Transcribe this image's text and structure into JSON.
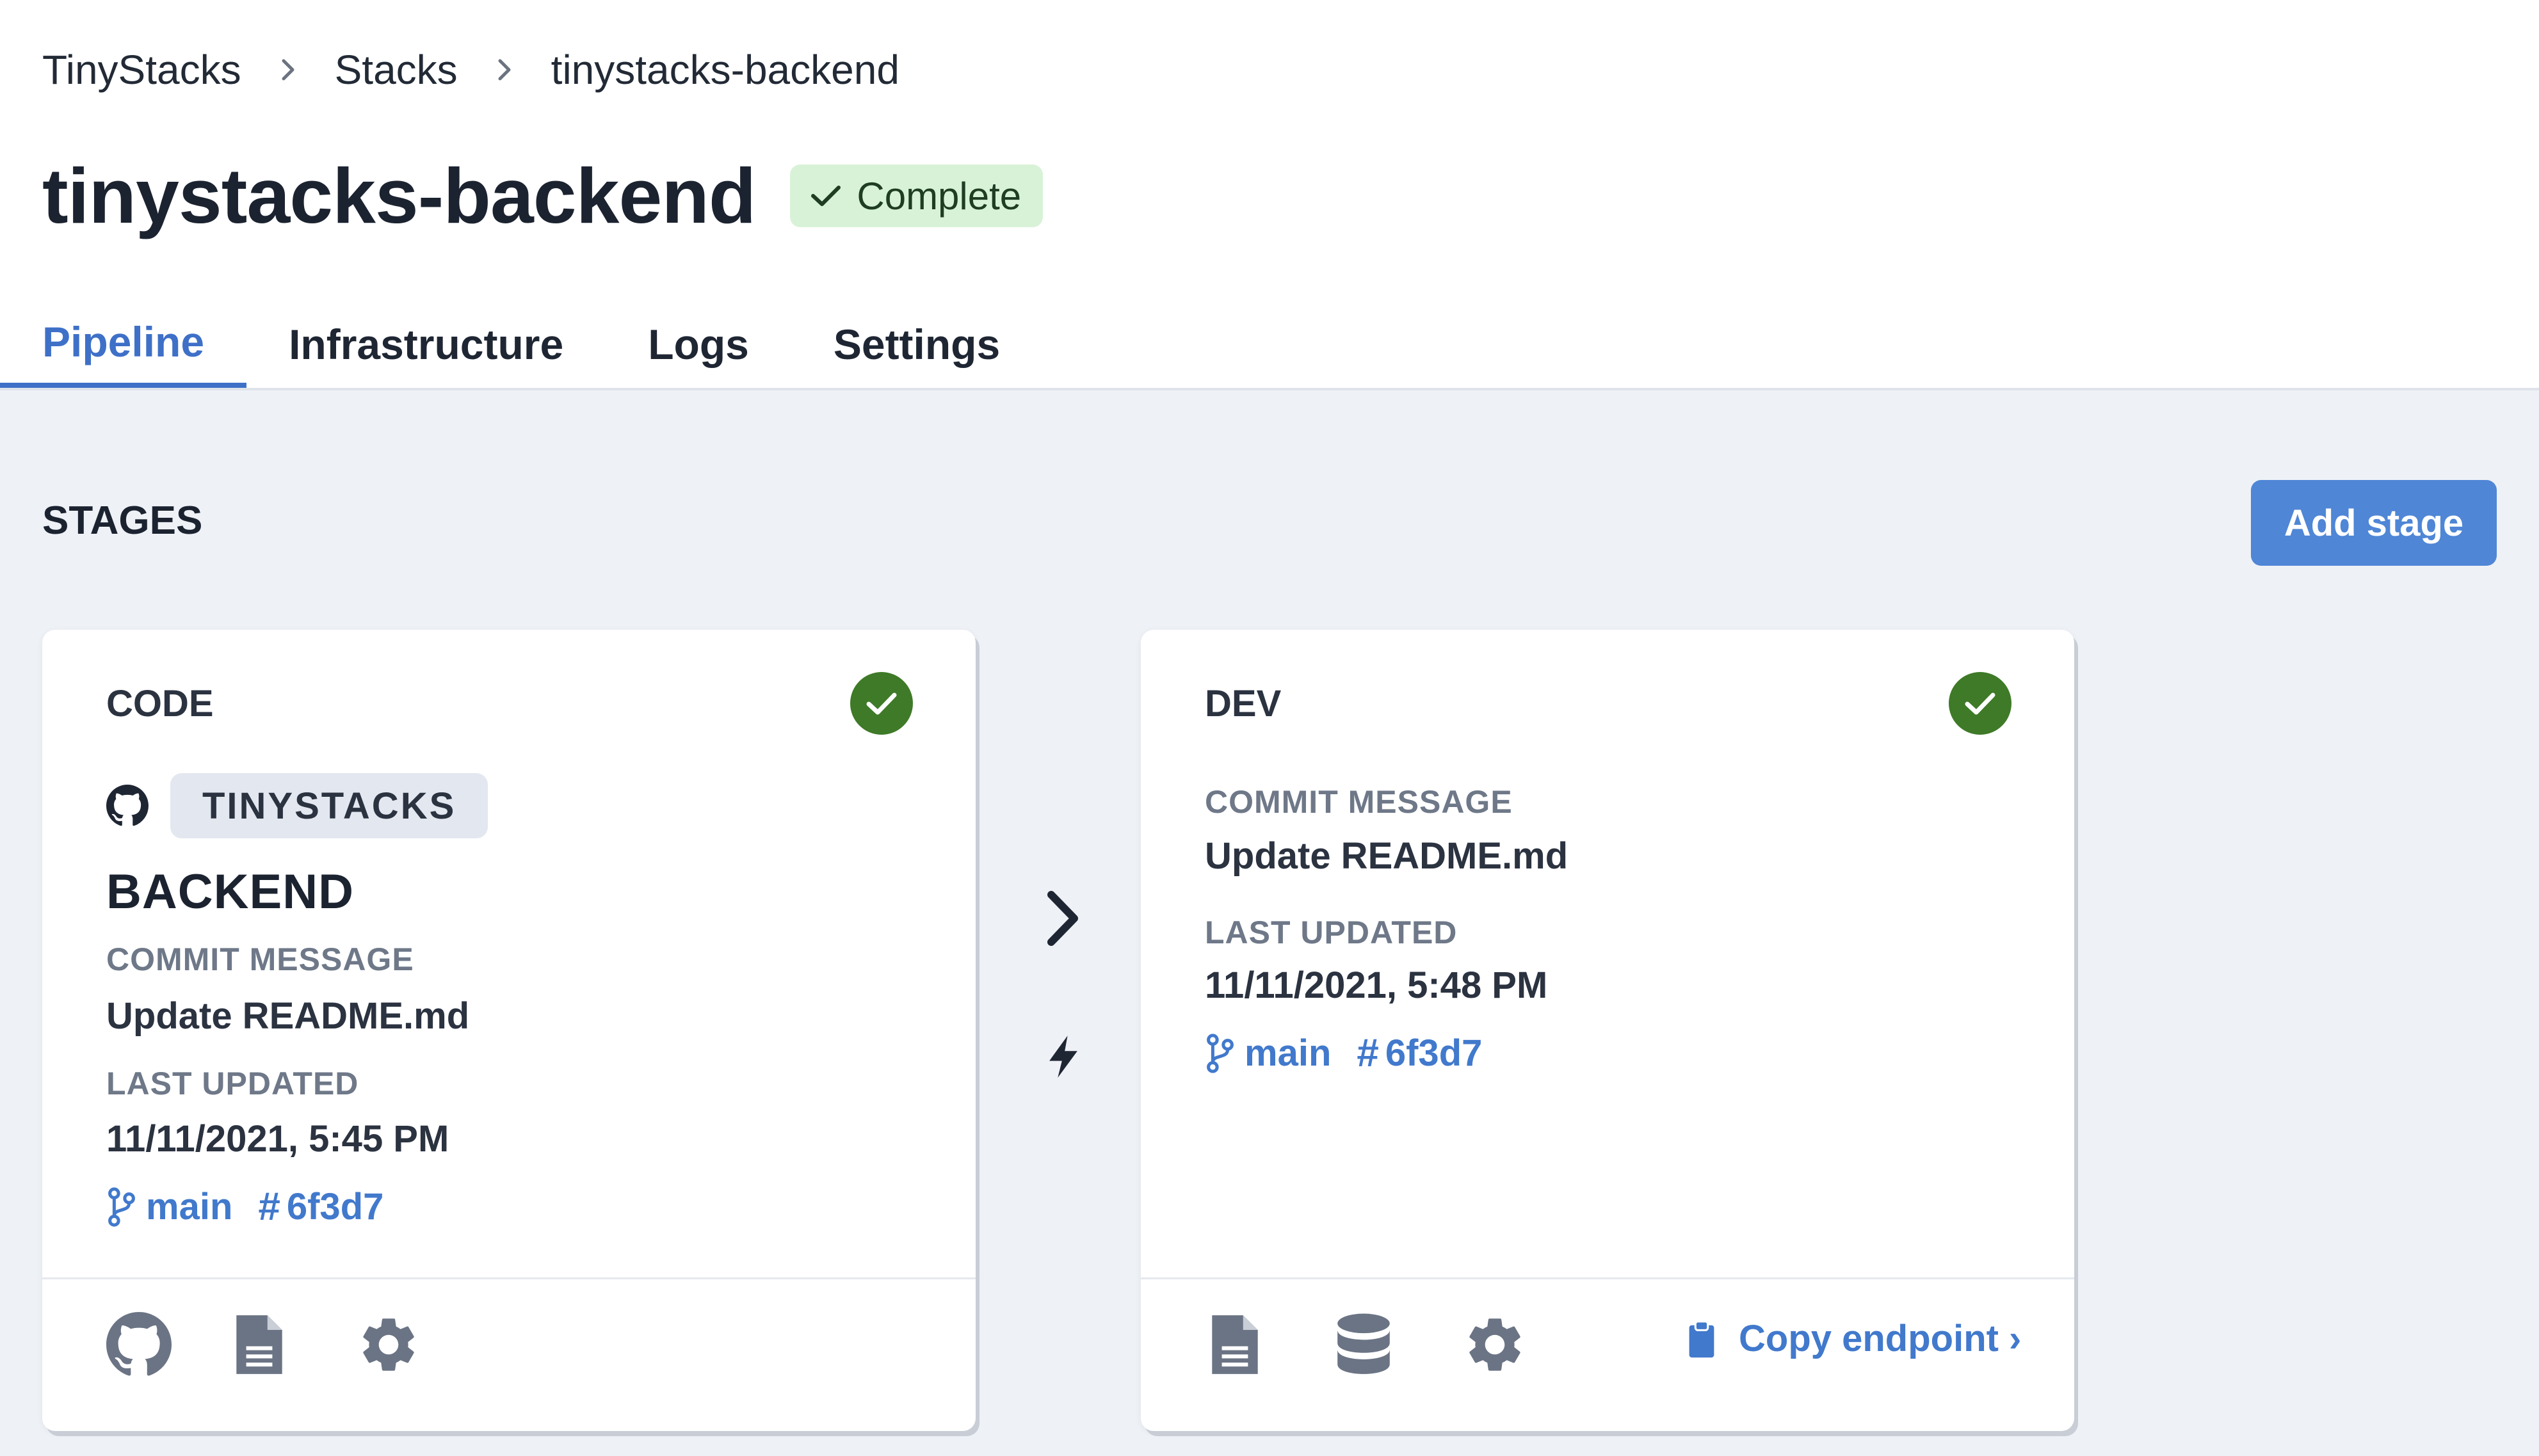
{
  "breadcrumb": {
    "items": [
      "TinyStacks",
      "Stacks",
      "tinystacks-backend"
    ]
  },
  "page": {
    "title": "tinystacks-backend",
    "status": "Complete"
  },
  "tabs": [
    "Pipeline",
    "Infrastructure",
    "Logs",
    "Settings"
  ],
  "stages": {
    "heading": "STAGES",
    "add_button": "Add stage",
    "code": {
      "title": "CODE",
      "repo_owner": "TINYSTACKS",
      "repo_name": "BACKEND",
      "commit_label": "COMMIT MESSAGE",
      "commit_message": "Update README.md",
      "updated_label": "LAST UPDATED",
      "updated_value": "11/11/2021, 5:45 PM",
      "branch": "main",
      "commit_hash": "6f3d7"
    },
    "dev": {
      "title": "DEV",
      "commit_label": "COMMIT MESSAGE",
      "commit_message": "Update README.md",
      "updated_label": "LAST UPDATED",
      "updated_value": "11/11/2021, 5:48 PM",
      "branch": "main",
      "commit_hash": "6f3d7",
      "copy_label": "Copy endpoint ›"
    }
  },
  "colors": {
    "accent": "#4179cc",
    "success": "#3e7a27",
    "badge_bg": "#d8f2d7"
  },
  "icons": [
    "check-icon",
    "chevron-right-icon",
    "github-icon",
    "git-branch-icon",
    "hash-icon",
    "bolt-icon",
    "file-icon",
    "database-icon",
    "gear-icon",
    "clipboard-icon"
  ]
}
